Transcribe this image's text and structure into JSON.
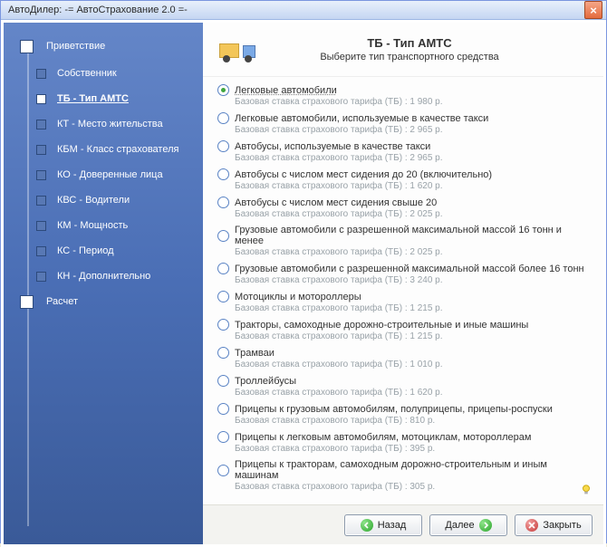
{
  "window": {
    "title": "АвтоДилер:  -= АвтоСтрахование 2.0 =-"
  },
  "sidebar": {
    "top": "Приветствие",
    "bottom": "Расчет",
    "items": [
      {
        "label": "Собственник"
      },
      {
        "label": "ТБ - Тип АМТС",
        "active": true
      },
      {
        "label": "КТ - Место жительства"
      },
      {
        "label": "КБМ - Класс страхователя"
      },
      {
        "label": "КО - Доверенные лица"
      },
      {
        "label": "КВС - Водители"
      },
      {
        "label": "КМ - Мощность"
      },
      {
        "label": "КС - Период"
      },
      {
        "label": "КН - Дополнительно"
      }
    ]
  },
  "header": {
    "title": "ТБ - Тип АМТС",
    "subtitle": "Выберите тип транспортного средства"
  },
  "rate_prefix": "Базовая ставка страхового тарифа (ТБ) :  ",
  "rate_suffix": " р.",
  "options": [
    {
      "label": "Легковые автомобили",
      "rate": "1 980",
      "selected": true
    },
    {
      "label": "Легковые автомобили, используемые в качестве такси",
      "rate": "2 965"
    },
    {
      "label": "Автобусы, используемые в качестве такси",
      "rate": "2 965"
    },
    {
      "label": "Автобусы с числом мест сидения до 20 (включительно)",
      "rate": "1 620"
    },
    {
      "label": "Автобусы с числом мест сидения свыше 20",
      "rate": "2 025"
    },
    {
      "label": "Грузовые автомобили с разрешенной максимальной массой 16 тонн и менее",
      "rate": "2 025"
    },
    {
      "label": "Грузовые автомобили с разрешенной максимальной массой более 16 тонн",
      "rate": "3 240"
    },
    {
      "label": "Мотоциклы и мотороллеры",
      "rate": "1 215"
    },
    {
      "label": "Тракторы, самоходные дорожно-строительные и иные машины",
      "rate": "1 215"
    },
    {
      "label": "Трамваи",
      "rate": "1 010"
    },
    {
      "label": "Троллейбусы",
      "rate": "1 620"
    },
    {
      "label": "Прицепы к грузовым автомобилям, полуприцепы, прицепы-роспуски",
      "rate": "810"
    },
    {
      "label": "Прицепы к легковым автомобилям, мотоциклам, мотороллерам",
      "rate": "395"
    },
    {
      "label": "Прицепы к тракторам, самоходным дорожно-строительным и иным машинам",
      "rate": "305"
    }
  ],
  "footer": {
    "back": "Назад",
    "next": "Далее",
    "close": "Закрыть"
  }
}
